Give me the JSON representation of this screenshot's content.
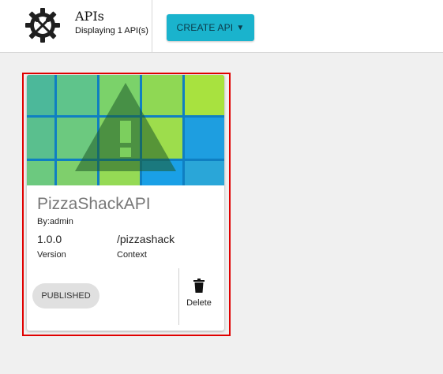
{
  "header": {
    "title": "APIs",
    "subtitle": "Displaying 1 API(s)",
    "create_button": {
      "label": "CREATE API",
      "caret": "▼"
    },
    "logo_icon": "gear-tools-icon"
  },
  "api_card": {
    "thumbnail_icon": "warning-triangle-icon",
    "name": "PizzaShackAPI",
    "author": "By:admin",
    "version_value": "1.0.0",
    "version_label": "Version",
    "context_value": "/pizzashack",
    "context_label": "Context",
    "status": "PUBLISHED",
    "delete_label": "Delete",
    "delete_icon": "trash-icon",
    "highlight_color": "#e00000"
  },
  "colors": {
    "accent": "#1ab3cd",
    "thumbnail_palette": [
      "#4cb89a",
      "#5fc48b",
      "#7bd26a",
      "#8fd854",
      "#a8e23f",
      "#1e9ee0",
      "#3d8f3a"
    ]
  }
}
